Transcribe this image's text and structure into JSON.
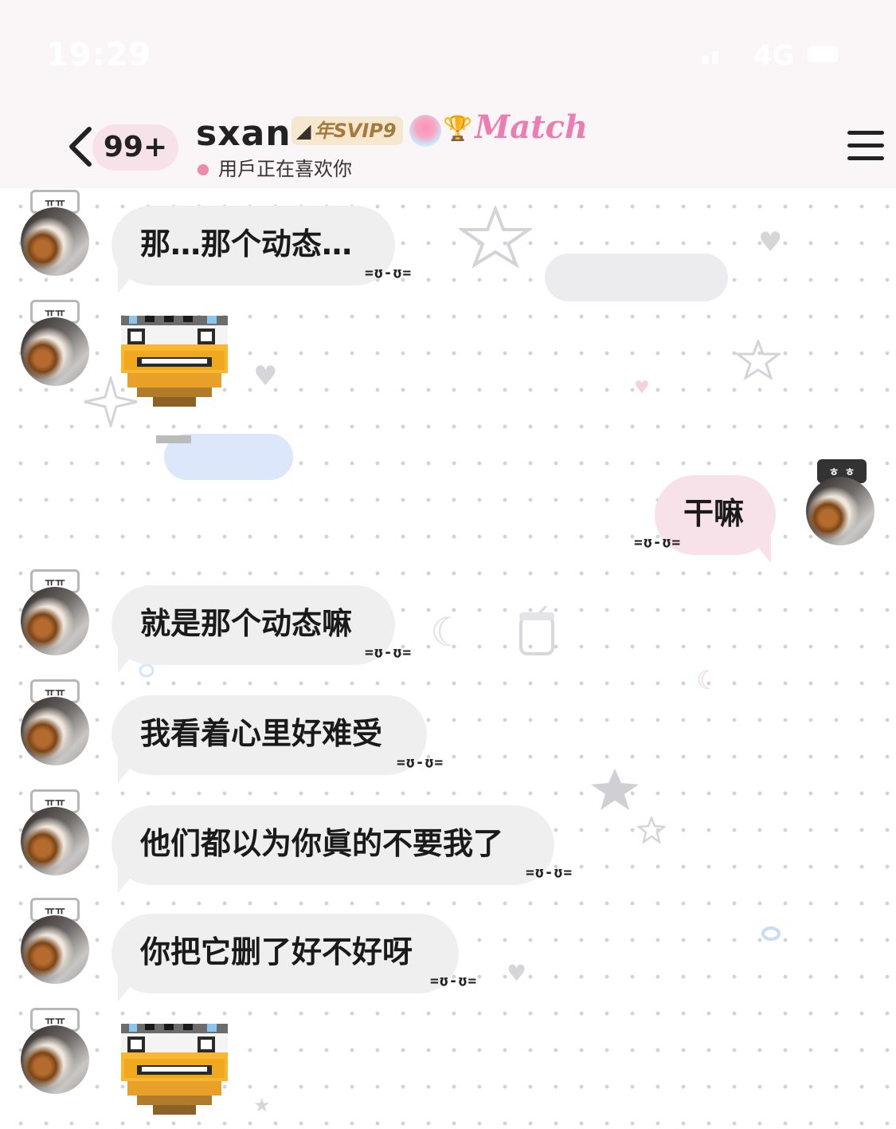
{
  "status_bar": {
    "time": "19:29",
    "network": "4G"
  },
  "header": {
    "unread_badge": "99+",
    "contact_name": "sxan",
    "vip_badge": "年SVIP9",
    "match_label": "Match",
    "typing_status": "用戶正在喜欢你"
  },
  "messages": [
    {
      "type": "text",
      "from": "them",
      "face": "ㅠㅠ",
      "text": "那…那个动态…",
      "suffix": "=ʊ-ʊ="
    },
    {
      "type": "sticker",
      "from": "them",
      "face": "ㅠㅠ",
      "sticker": "pixel-bee-sticker"
    },
    {
      "type": "text",
      "from": "me",
      "face": "ㅎ_ㅎ",
      "text": "干嘛",
      "suffix": "=ʊ-ʊ="
    },
    {
      "type": "text",
      "from": "them",
      "face": "ㅠㅠ",
      "text": "就是那个动态嘛",
      "suffix": "=ʊ-ʊ="
    },
    {
      "type": "text",
      "from": "them",
      "face": "ㅠㅠ",
      "text": "我看着心里好难受",
      "suffix": "=ʊ-ʊ="
    },
    {
      "type": "text",
      "from": "them",
      "face": "ㅠㅠ",
      "text": "他们都以为你眞的不要我了",
      "suffix": "=ʊ-ʊ="
    },
    {
      "type": "text",
      "from": "them",
      "face": "ㅠㅠ",
      "text": "你把它删了好不好呀",
      "suffix": "=ʊ-ʊ="
    },
    {
      "type": "sticker",
      "from": "them",
      "face": "ㅠㅠ",
      "sticker": "pixel-bee-sticker"
    }
  ],
  "colors": {
    "header_bg": "#faf6f8",
    "bubble_other": "#efefef",
    "bubble_me": "#f7e2ea",
    "typing_dot": "#ec8aa9",
    "match_pink": "#ec7db2",
    "vip_gold": "#a57a3e"
  }
}
